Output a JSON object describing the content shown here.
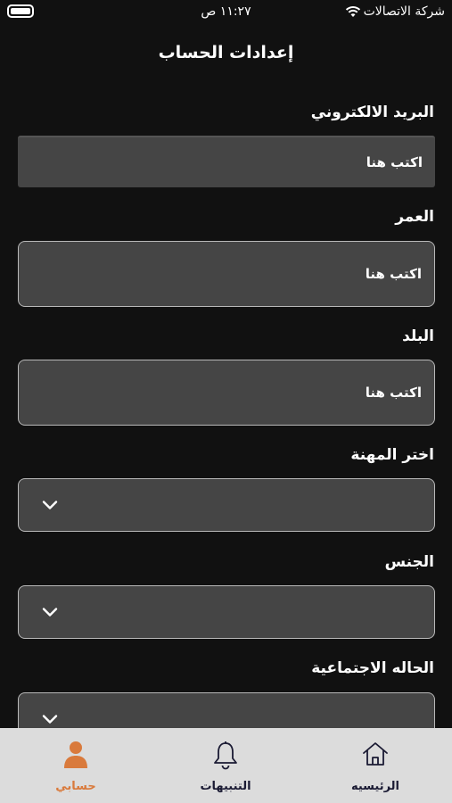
{
  "status_bar": {
    "time": "١١:٢٧ ص",
    "carrier": "شركة الاتصالات"
  },
  "header": {
    "title": "إعدادات الحساب"
  },
  "form": {
    "email": {
      "label": "البريد الالكتروني",
      "placeholder": "اكتب هنا"
    },
    "age": {
      "label": "العمر",
      "placeholder": "اكتب هنا"
    },
    "country": {
      "label": "البلد",
      "placeholder": "اكتب هنا"
    },
    "profession": {
      "label": "اختر المهنة"
    },
    "gender": {
      "label": "الجنس"
    },
    "marital_status": {
      "label": "الحاله الاجتماعية"
    }
  },
  "bottom_nav": {
    "items": [
      {
        "label": "حسابي",
        "icon": "user-icon",
        "active": true
      },
      {
        "label": "التنبيهات",
        "icon": "bell-icon",
        "active": false
      },
      {
        "label": "الرئيسيه",
        "icon": "home-icon",
        "active": false
      }
    ]
  },
  "colors": {
    "background": "#111111",
    "field": "#454545",
    "accent": "#d97a3c",
    "nav_background": "#dcdcdc"
  }
}
